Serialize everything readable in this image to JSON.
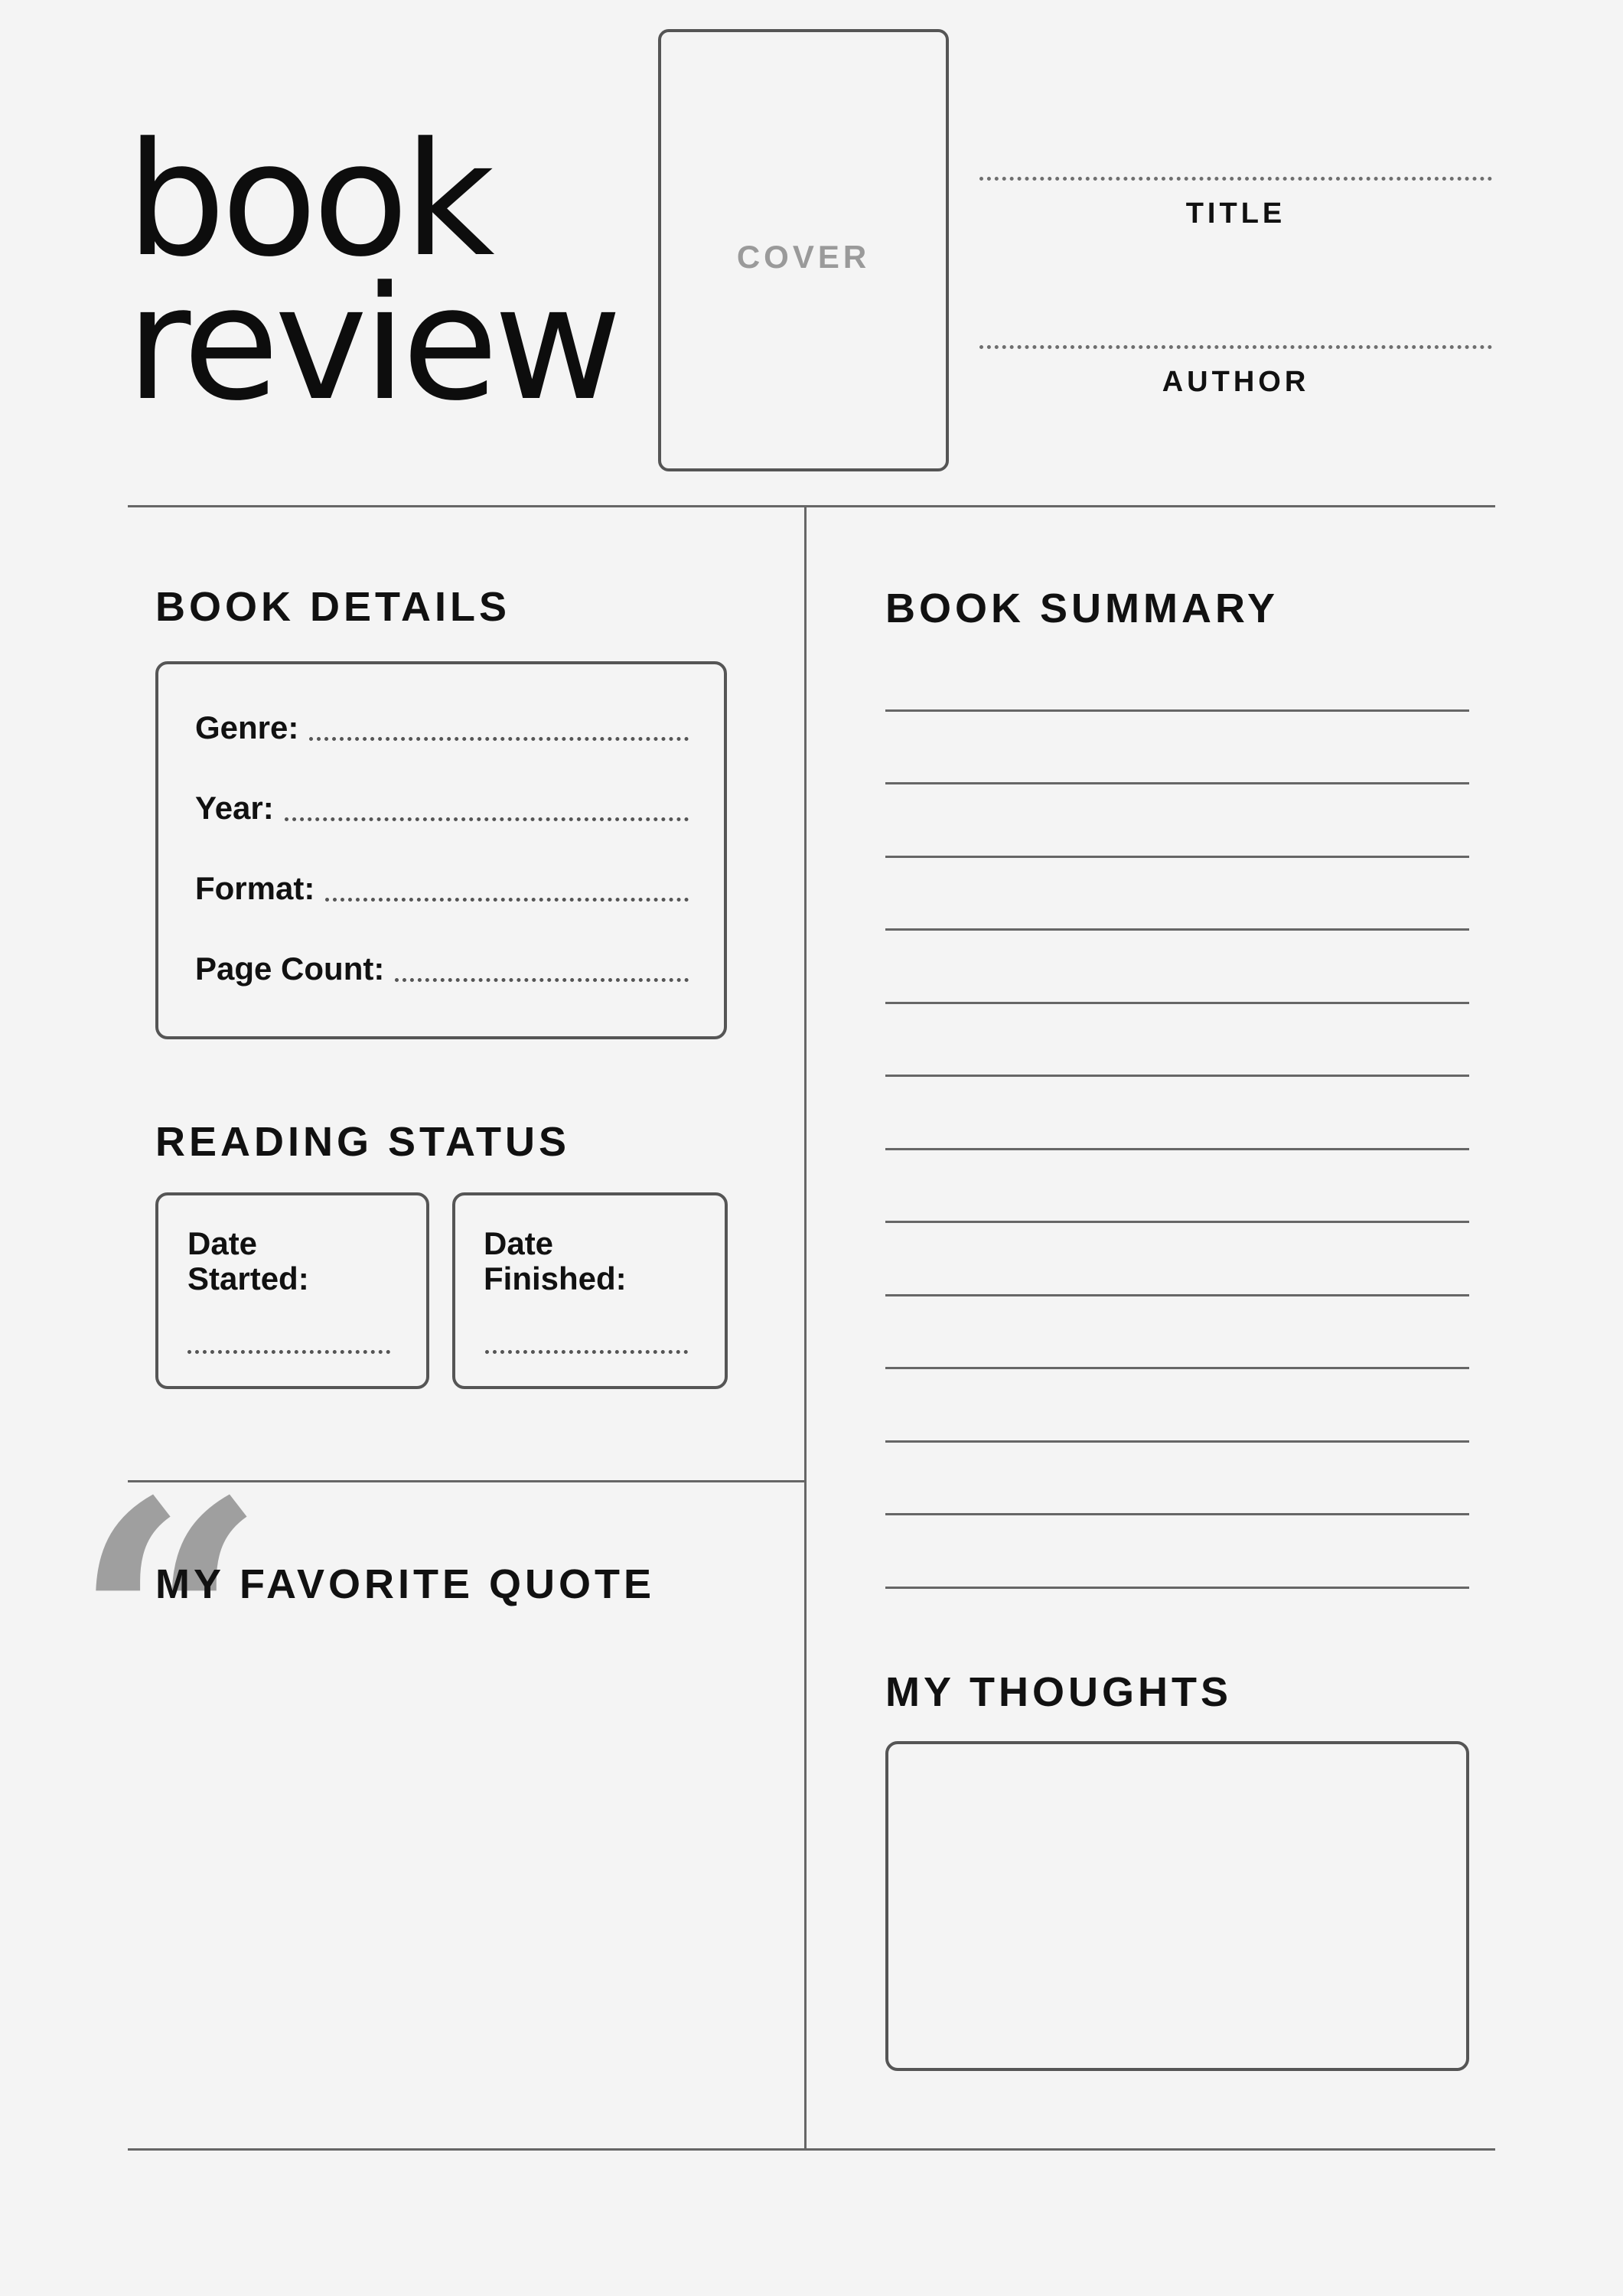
{
  "header": {
    "title_line1": "book",
    "title_line2": "review",
    "cover_label": "COVER",
    "title_label": "TITLE",
    "author_label": "AUTHOR"
  },
  "book_details": {
    "heading": "BOOK DETAILS",
    "fields": [
      {
        "label": "Genre:"
      },
      {
        "label": "Year:"
      },
      {
        "label": "Format:"
      },
      {
        "label": "Page Count:"
      }
    ]
  },
  "reading_status": {
    "heading": "READING STATUS",
    "started": {
      "line1": "Date",
      "line2": "Started:"
    },
    "finished": {
      "line1": "Date",
      "line2": "Finished:"
    }
  },
  "quote": {
    "heading": "MY FAVORITE QUOTE",
    "mark": "“"
  },
  "summary": {
    "heading": "BOOK SUMMARY"
  },
  "thoughts": {
    "heading": "MY THOUGHTS"
  },
  "colors": {
    "background": "#f4f4f4",
    "text": "#111111",
    "border": "#555555",
    "muted": "#9a9a9a"
  }
}
